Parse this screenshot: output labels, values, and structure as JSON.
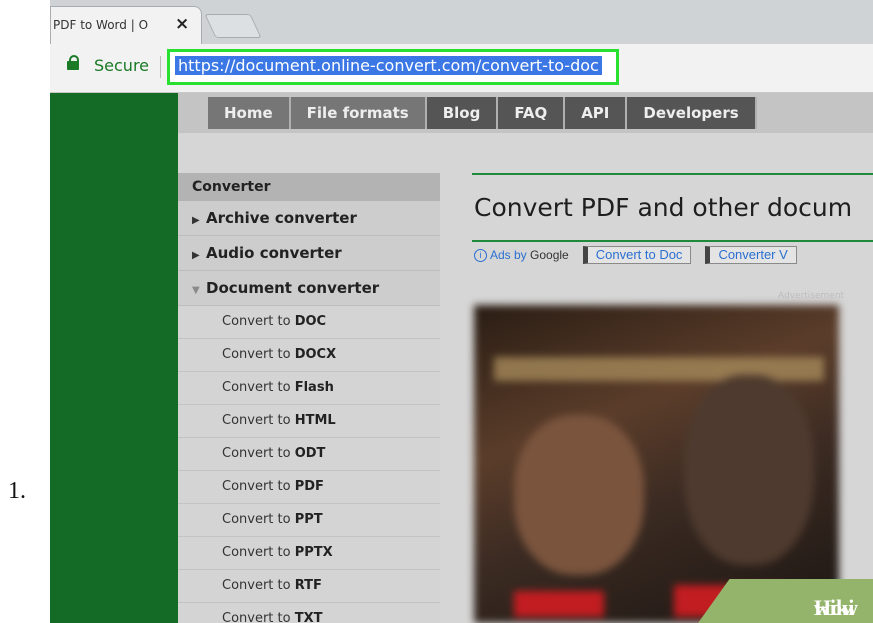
{
  "step_number": "1.",
  "browser": {
    "tab_title": "PDF to Word | O",
    "tab_close": "×",
    "secure_label": "Secure",
    "url": "https://document.online-convert.com/convert-to-doc"
  },
  "site": {
    "nav": [
      "Home",
      "File formats",
      "Blog",
      "FAQ",
      "API",
      "Developers"
    ],
    "sidebar": {
      "header": "Converter",
      "categories": [
        "Archive converter",
        "Audio converter",
        "Document converter"
      ],
      "items": [
        {
          "prefix": "Convert to ",
          "format": "DOC"
        },
        {
          "prefix": "Convert to ",
          "format": "DOCX"
        },
        {
          "prefix": "Convert to ",
          "format": "Flash"
        },
        {
          "prefix": "Convert to ",
          "format": "HTML"
        },
        {
          "prefix": "Convert to ",
          "format": "ODT"
        },
        {
          "prefix": "Convert to ",
          "format": "PDF"
        },
        {
          "prefix": "Convert to ",
          "format": "PPT"
        },
        {
          "prefix": "Convert to ",
          "format": "PPTX"
        },
        {
          "prefix": "Convert to ",
          "format": "RTF"
        },
        {
          "prefix": "Convert to ",
          "format": "TXT"
        }
      ]
    },
    "heading": "Convert PDF and other docum",
    "ads": {
      "label": "Ads by",
      "brand": "Google",
      "links": [
        "Convert to Doc",
        "Converter V"
      ]
    },
    "advert_label": "Advertisement"
  },
  "watermark": {
    "wiki": "wiki",
    "how": "How"
  },
  "colors": {
    "highlight_box": "#27e02f",
    "brand_green": "#136b26",
    "url_selection": "#3b78e6"
  }
}
